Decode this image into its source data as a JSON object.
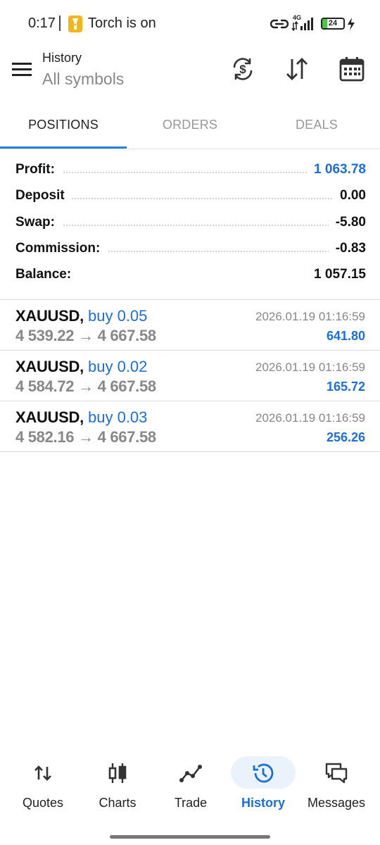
{
  "status_bar": {
    "time": "0:17",
    "torch_text": "Torch is on",
    "network": "4G",
    "battery": 24,
    "battery_label": "24"
  },
  "header": {
    "title": "History",
    "subtitle": "All symbols",
    "icons": [
      "currency-refresh-icon",
      "sort-icon",
      "calendar-icon"
    ]
  },
  "tabs": [
    {
      "label": "POSITIONS",
      "active": true
    },
    {
      "label": "ORDERS",
      "active": false
    },
    {
      "label": "DEALS",
      "active": false
    }
  ],
  "summary": [
    {
      "label": "Profit:",
      "value": "1 063.78",
      "highlight": true
    },
    {
      "label": "Deposit",
      "value": "0.00",
      "highlight": false
    },
    {
      "label": "Swap:",
      "value": "-5.80",
      "highlight": false
    },
    {
      "label": "Commission:",
      "value": "-0.83",
      "highlight": false
    },
    {
      "label": "Balance:",
      "value": "1 057.15",
      "highlight": false
    }
  ],
  "positions": [
    {
      "symbol": "XAUUSD,",
      "side": "buy 0.05",
      "open_price": "4 539.22",
      "arrow": "→",
      "close_price": "4 667.58",
      "time": "2026.01.19 01:16:59",
      "profit": "641.80"
    },
    {
      "symbol": "XAUUSD,",
      "side": "buy 0.02",
      "open_price": "4 584.72",
      "arrow": "→",
      "close_price": "4 667.58",
      "time": "2026.01.19 01:16:59",
      "profit": "165.72"
    },
    {
      "symbol": "XAUUSD,",
      "side": "buy 0.03",
      "open_price": "4 582.16",
      "arrow": "→",
      "close_price": "4 667.58",
      "time": "2026.01.19 01:16:59",
      "profit": "256.26"
    }
  ],
  "bottom_nav": [
    {
      "label": "Quotes",
      "icon": "quotes-icon",
      "active": false
    },
    {
      "label": "Charts",
      "icon": "charts-icon",
      "active": false
    },
    {
      "label": "Trade",
      "icon": "trade-icon",
      "active": false
    },
    {
      "label": "History",
      "icon": "history-icon",
      "active": true
    },
    {
      "label": "Messages",
      "icon": "messages-icon",
      "active": false
    }
  ],
  "colors": {
    "accent": "#1d6fd8",
    "tab_indicator": "#2a7de1",
    "muted": "#888888",
    "nav_active_bg": "#eaf2fb"
  }
}
